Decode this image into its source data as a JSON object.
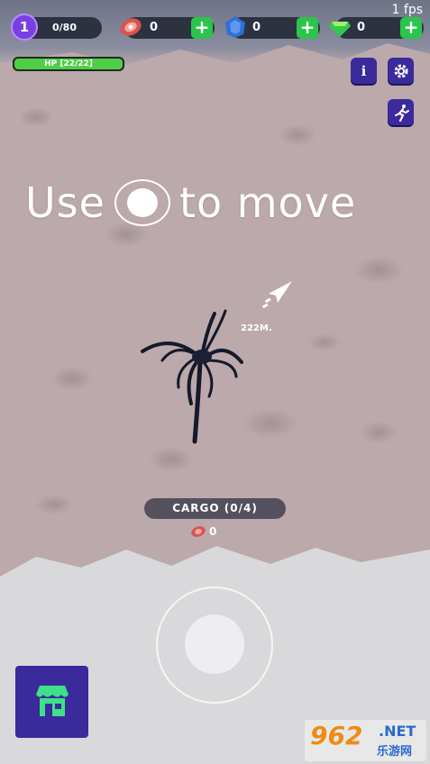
{
  "hud": {
    "fps": "1 fps",
    "level": "1",
    "xp": "0/80",
    "hp_text": "HP [22/22]",
    "hp_fraction": 1.0
  },
  "resources": [
    {
      "name": "meat",
      "icon": "meat-icon",
      "value": "0",
      "color": "#d9534f"
    },
    {
      "name": "gems",
      "icon": "blue-gem-icon",
      "value": "0",
      "color": "#2f6fd6"
    },
    {
      "name": "emeralds",
      "icon": "green-gem-icon",
      "value": "0",
      "color": "#33c84a"
    }
  ],
  "buttons": {
    "info_icon": "i",
    "add_icon": "+"
  },
  "hint": {
    "before": "Use",
    "after": "to move"
  },
  "target": {
    "distance": "222M."
  },
  "cargo": {
    "label": "CARGO (0/4)",
    "meat_count": "0"
  },
  "watermark": {
    "number": "962",
    "suffix": ".NET",
    "chinese": "乐游网"
  },
  "colors": {
    "accent": "#3a2a9c",
    "plus": "#2ac54a",
    "hp": "#4fcf48"
  }
}
